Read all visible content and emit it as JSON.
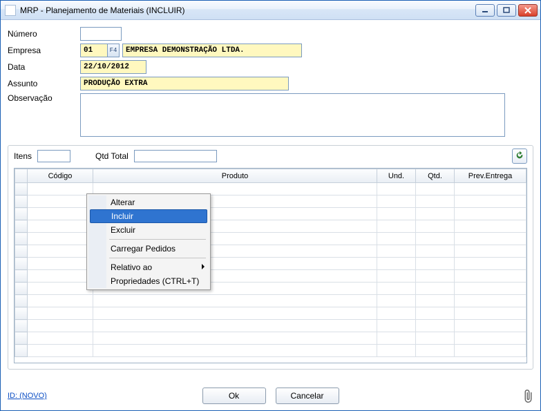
{
  "window": {
    "title": "MRP - Planejamento de Materiais (INCLUIR)"
  },
  "form": {
    "numero_label": "Número",
    "numero_value": "",
    "empresa_label": "Empresa",
    "empresa_code": "01",
    "empresa_f4": "F4",
    "empresa_name": "EMPRESA DEMONSTRAÇÃO LTDA.",
    "data_label": "Data",
    "data_value": "22/10/2012",
    "assunto_label": "Assunto",
    "assunto_value": "PRODUÇÃO EXTRA",
    "observ_label": "Observação",
    "observ_value": ""
  },
  "items": {
    "itens_label": "Itens",
    "itens_value": "",
    "qtdtotal_label": "Qtd Total",
    "qtdtotal_value": "",
    "columns": {
      "codigo": "Código",
      "produto": "Produto",
      "und": "Und.",
      "qtd": "Qtd.",
      "prev": "Prev.Entrega"
    }
  },
  "context_menu": {
    "alterar": "Alterar",
    "incluir": "Incluir",
    "excluir": "Excluir",
    "carregar": "Carregar Pedidos",
    "relativo": "Relativo ao",
    "props": "Propriedades (CTRL+T)"
  },
  "footer": {
    "id_link": "ID: (NOVO)",
    "ok": "Ok",
    "cancel": "Cancelar"
  }
}
